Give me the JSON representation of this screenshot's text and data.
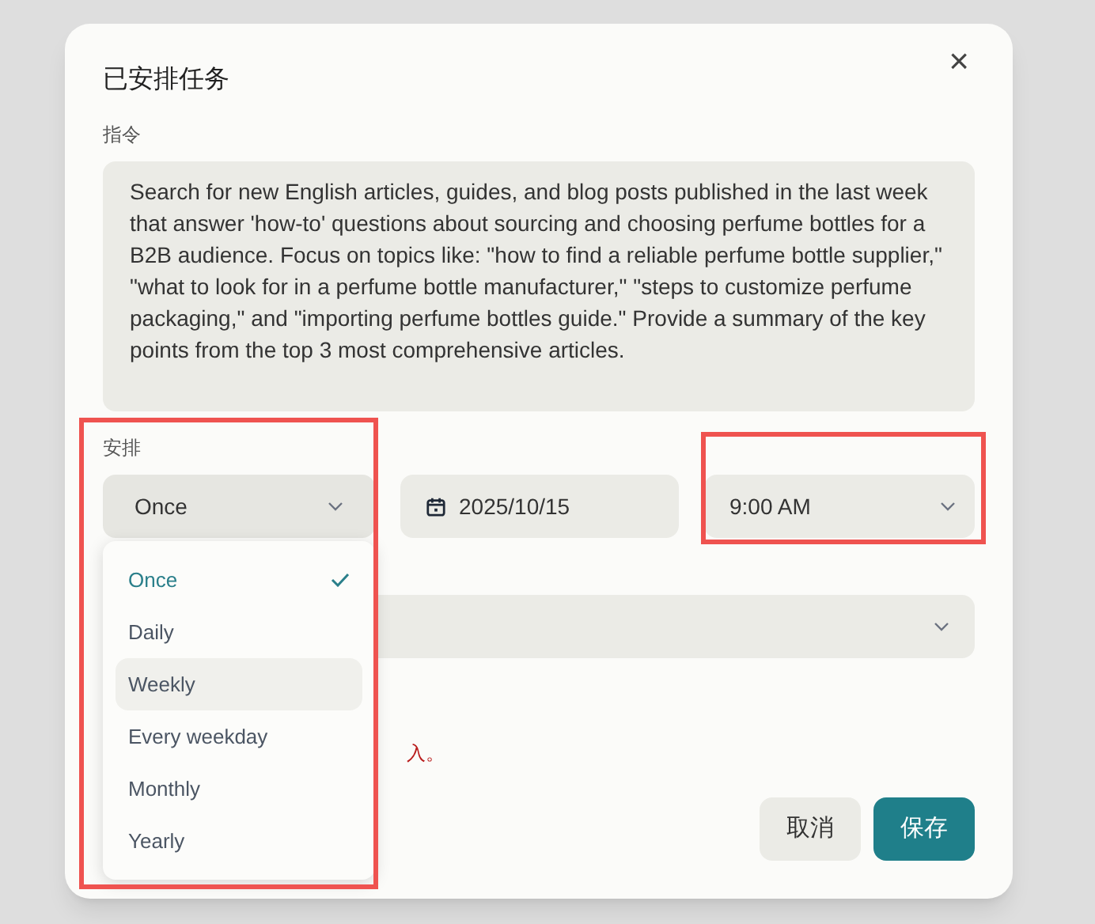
{
  "dialog": {
    "title": "已安排任务",
    "close": "×"
  },
  "instruction": {
    "label": "指令",
    "value": "Search for new English articles, guides, and blog posts published in the last week that answer 'how-to' questions about sourcing and choosing perfume bottles for a B2B audience. Focus on topics like: \"how to find a reliable perfume bottle supplier,\" \"what to look for in a perfume bottle manufacturer,\" \"steps to customize perfume packaging,\" and \"importing perfume bottles guide.\" Provide a summary of the key points from the top 3 most comprehensive articles."
  },
  "schedule": {
    "label": "安排",
    "frequency": "Once",
    "date": "2025/10/15",
    "time": "9:00 AM",
    "expanded": true
  },
  "frequency_options": [
    {
      "label": "Once",
      "selected": true,
      "hovered": false
    },
    {
      "label": "Daily",
      "selected": false,
      "hovered": false
    },
    {
      "label": "Weekly",
      "selected": false,
      "hovered": true
    },
    {
      "label": "Every weekday",
      "selected": false,
      "hovered": false
    },
    {
      "label": "Monthly",
      "selected": false,
      "hovered": false
    },
    {
      "label": "Yearly",
      "selected": false,
      "hovered": false
    }
  ],
  "error_text": "入。",
  "buttons": [
    {
      "label": "取消",
      "kind": "secondary"
    },
    {
      "label": "保存",
      "kind": "primary"
    }
  ]
}
